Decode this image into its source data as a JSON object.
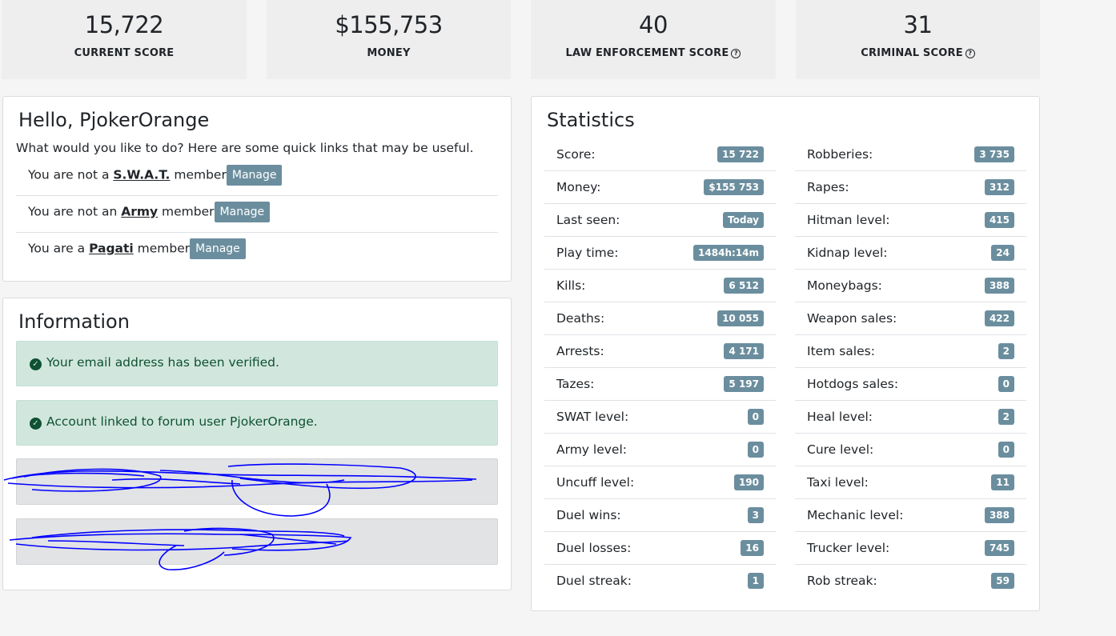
{
  "top_stats": [
    {
      "value": "15,722",
      "label": "CURRENT SCORE",
      "help": false
    },
    {
      "value": "$155,753",
      "label": "MONEY",
      "help": false
    },
    {
      "value": "40",
      "label": "LAW ENFORCEMENT SCORE",
      "help": true
    },
    {
      "value": "31",
      "label": "CRIMINAL SCORE",
      "help": true
    }
  ],
  "welcome": {
    "title": "Hello, PjokerOrange",
    "intro": "What would you like to do? Here are some quick links that may be useful.",
    "memberships": [
      {
        "prefix": "You are not a ",
        "group": "S.W.A.T.",
        "suffix": " member",
        "button": "Manage"
      },
      {
        "prefix": "You are not an ",
        "group": "Army",
        "suffix": " member",
        "button": "Manage"
      },
      {
        "prefix": "You are a ",
        "group": "Pagati",
        "suffix": " member",
        "button": "Manage"
      }
    ]
  },
  "information": {
    "title": "Information",
    "alerts": [
      "Your email address has been verified.",
      "Account linked to forum user PjokerOrange."
    ]
  },
  "statistics": {
    "title": "Statistics",
    "left": [
      {
        "label": "Score:",
        "value": "15 722"
      },
      {
        "label": "Money:",
        "value": "$155 753"
      },
      {
        "label": "Last seen:",
        "value": "Today"
      },
      {
        "label": "Play time:",
        "value": "1484h:14m"
      },
      {
        "label": "Kills:",
        "value": "6 512"
      },
      {
        "label": "Deaths:",
        "value": "10 055"
      },
      {
        "label": "Arrests:",
        "value": "4 171"
      },
      {
        "label": "Tazes:",
        "value": "5 197"
      },
      {
        "label": "SWAT level:",
        "value": "0"
      },
      {
        "label": "Army level:",
        "value": "0"
      },
      {
        "label": "Uncuff level:",
        "value": "190"
      },
      {
        "label": "Duel wins:",
        "value": "3"
      },
      {
        "label": "Duel losses:",
        "value": "16"
      },
      {
        "label": "Duel streak:",
        "value": "1"
      }
    ],
    "right": [
      {
        "label": "Robberies:",
        "value": "3 735"
      },
      {
        "label": "Rapes:",
        "value": "312"
      },
      {
        "label": "Hitman level:",
        "value": "415"
      },
      {
        "label": "Kidnap level:",
        "value": "24"
      },
      {
        "label": "Moneybags:",
        "value": "388"
      },
      {
        "label": "Weapon sales:",
        "value": "422"
      },
      {
        "label": "Item sales:",
        "value": "2"
      },
      {
        "label": "Hotdogs sales:",
        "value": "0"
      },
      {
        "label": "Heal level:",
        "value": "2"
      },
      {
        "label": "Cure level:",
        "value": "0"
      },
      {
        "label": "Taxi level:",
        "value": "11"
      },
      {
        "label": "Mechanic level:",
        "value": "388"
      },
      {
        "label": "Trucker level:",
        "value": "745"
      },
      {
        "label": "Rob streak:",
        "value": "59"
      }
    ]
  },
  "colors": {
    "badge": "#6b8e9e",
    "success_bg": "#d1e7dd",
    "success_text": "#0f5132",
    "scribble": "#0000ff"
  }
}
